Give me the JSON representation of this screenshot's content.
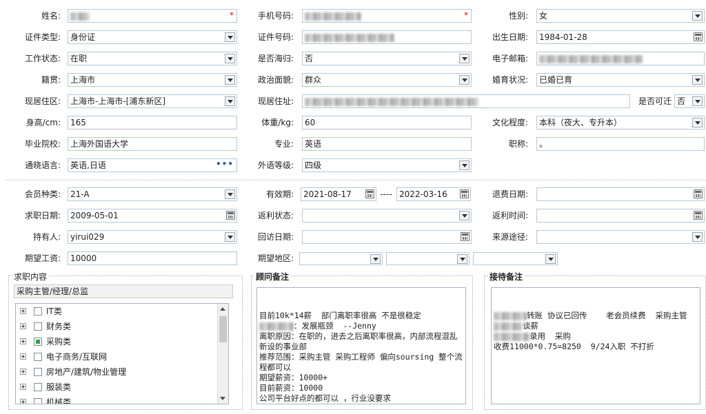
{
  "row1": {
    "name_label": "姓名:",
    "phone_label": "手机号码:",
    "gender_label": "性别:",
    "gender_value": "女",
    "required_mark": "*"
  },
  "row2": {
    "id_type_label": "证件类型:",
    "id_type_value": "身份证",
    "id_no_label": "证件号码:",
    "birth_label": "出生日期:",
    "birth_value": "1984-01-28"
  },
  "row3": {
    "work_status_label": "工作状态:",
    "work_status_value": "在职",
    "returnee_label": "是否海归:",
    "returnee_value": "否",
    "email_label": "电子邮箱:"
  },
  "row4": {
    "native_label": "籍贯:",
    "native_value": "上海市",
    "political_label": "政治面貌:",
    "political_value": "群众",
    "marital_label": "婚育状况:",
    "marital_value": "已婚已育"
  },
  "row5": {
    "residence_area_label": "现居住区:",
    "residence_area_value": "上海市-上海市-[浦东新区]",
    "address_label": "现居住址:",
    "relocate_label": "是否可迁",
    "relocate_value": "否"
  },
  "row6": {
    "height_label": "身高/cm:",
    "height_value": "165",
    "weight_label": "体重/kg:",
    "weight_value": "60",
    "education_label": "文化程度:",
    "education_value": "本科（夜大、专升本）"
  },
  "row7": {
    "school_label": "毕业院校:",
    "school_value": "上海外国语大学",
    "major_label": "专业:",
    "major_value": "英语",
    "title_label": "职称:",
    "title_value": "。"
  },
  "row8": {
    "language_label": "通晓语言:",
    "language_value": "英语,日语",
    "language_more": "•••",
    "foreign_level_label": "外语等级:",
    "foreign_level_value": "四级"
  },
  "member": {
    "type_label": "会员种类:",
    "type_value": "21-A",
    "validity_label": "有效期:",
    "validity_start": "2021-08-17",
    "validity_sep": "----",
    "validity_end": "2022-03-16",
    "refund_date_label": "退费日期:",
    "job_date_label": "求职日期:",
    "job_date_value": "2009-05-01",
    "rebate_status_label": "返利状态:",
    "rebate_time_label": "返利时间:",
    "holder_label": "持有人:",
    "holder_value": "yirui029",
    "revisit_label": "回访日期:",
    "source_label": "来源途径:",
    "salary_label": "期望工资:",
    "salary_value": "10000",
    "area_label": "期望地区:"
  },
  "job_content": {
    "title": "求职内容",
    "selected": "采购主管/经理/总监",
    "tree": [
      {
        "label": "IT类",
        "state": "none"
      },
      {
        "label": "财务类",
        "state": "none"
      },
      {
        "label": "采购类",
        "state": "partial"
      },
      {
        "label": "电子商务/互联网",
        "state": "none"
      },
      {
        "label": "房地产/建筑/物业管理",
        "state": "none"
      },
      {
        "label": "服装类",
        "state": "none"
      },
      {
        "label": "机械类",
        "state": "none"
      }
    ]
  },
  "consultant_notes": {
    "title": "顾问备注",
    "lines": [
      "目前10k*14薪  部门离职率很高 不是很稳定",
      "：发展瓶颈  --Jenny",
      "离职原因：在职的，进去之后离职率很高，内部流程混乱 新设的事业部",
      "推荐范围：采购主管 采购工程师 偏向soursing 整个流程都可以",
      "期望薪资：10000+",
      "目前薪资：10000",
      "公司平台好点的都可以 ，行业没要求"
    ]
  },
  "reception_notes": {
    "title": "接待备注",
    "lines": [
      "转账 协议已回传    老会员续费  采购主管",
      "谈薪",
      "录用  采购",
      "收费11000*0.75=8250  9/24入职 不打折"
    ]
  }
}
